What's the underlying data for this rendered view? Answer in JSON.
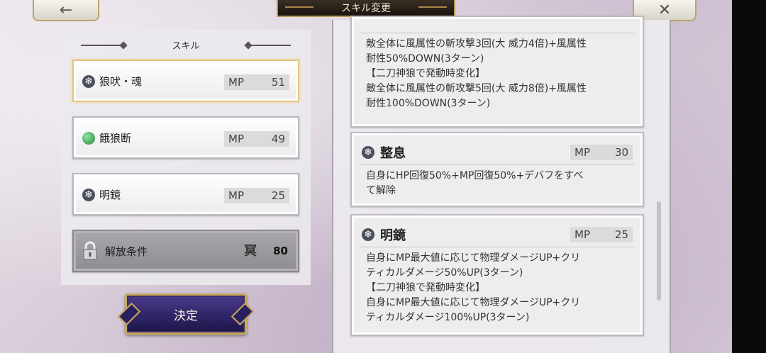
{
  "header": {
    "title": "スキル変更",
    "back_icon": "←",
    "close_icon": "✕"
  },
  "skill_panel": {
    "header": "スキル",
    "items": [
      {
        "name": "狼吠・魂",
        "mp_label": "MP",
        "mp": "51",
        "icon": "snowflake-icon"
      },
      {
        "name": "餓狼断",
        "mp_label": "MP",
        "mp": "49",
        "icon": "leaf-orb-icon"
      },
      {
        "name": "明鏡",
        "mp_label": "MP",
        "mp": "25",
        "icon": "snowflake-icon"
      }
    ],
    "locked": {
      "label": "解放条件",
      "cost_icon": "冥",
      "cost": "80"
    }
  },
  "decide_button": "決定",
  "details": {
    "card1": {
      "desc": "敵全体に風属性の斬攻撃3回(大 威力4倍)+風属性\n耐性50%DOWN(3ターン)\n【二刀神狼で発動時変化】\n敵全体に風属性の斬攻撃5回(大 威力8倍)+風属性\n耐性100%DOWN(3ターン)"
    },
    "card2": {
      "name": "整息",
      "mp_label": "MP",
      "mp": "30",
      "desc": "自身にHP回復50%+MP回復50%+デバフをすべ\nて解除"
    },
    "card3": {
      "name": "明鏡",
      "mp_label": "MP",
      "mp": "25",
      "desc": "自身にMP最大値に応じて物理ダメージUP+クリ\nティカルダメージ50%UP(3ターン)\n【二刀神狼で発動時変化】\n自身にMP最大値に応じて物理ダメージUP+クリ\nティカルダメージ100%UP(3ターン)"
    }
  },
  "icons": {
    "snowflake": "❄",
    "leaf": "◖"
  }
}
